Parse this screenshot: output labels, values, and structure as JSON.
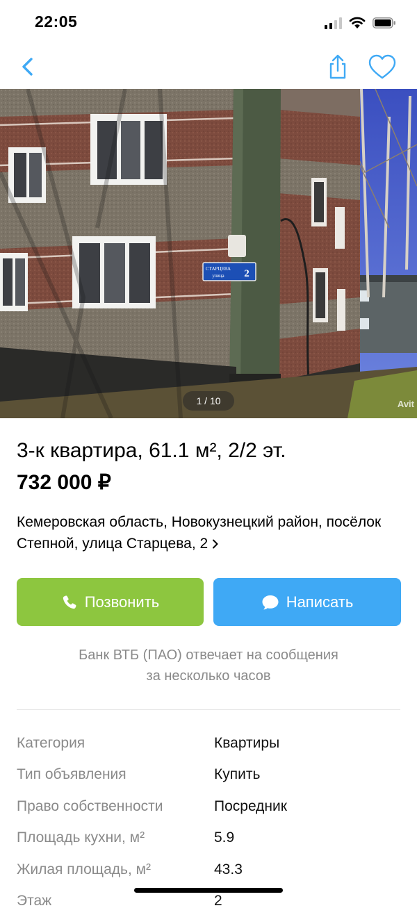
{
  "status_bar": {
    "time": "22:05"
  },
  "nav": {
    "back_icon": "chevron-left-icon",
    "share_icon": "share-icon",
    "favorite_icon": "heart-icon",
    "accent_color": "#3fa9f5"
  },
  "photo": {
    "counter": "1 / 10",
    "watermark": "Avit",
    "street_sign_line1": "СТАРЦЕВА",
    "street_sign_line2": "улица",
    "street_sign_number": "2"
  },
  "listing": {
    "title": "3-к квартира, 61.1 м², 2/2 эт.",
    "price": "732 000 ₽",
    "address": "Кемеровская область, Новокузнецкий район, посёлок Степной, улица Старцева, 2"
  },
  "actions": {
    "call_label": "Позвонить",
    "call_color": "#8dc63f",
    "write_label": "Написать",
    "write_color": "#3fa9f5"
  },
  "reply_note": {
    "line1": "Банк ВТБ (ПАО) отвечает на сообщения",
    "line2": "за несколько часов"
  },
  "params": [
    {
      "label": "Категория",
      "value": "Квартиры"
    },
    {
      "label": "Тип объявления",
      "value": "Купить"
    },
    {
      "label": "Право собственности",
      "value": "Посредник"
    },
    {
      "label": "Площадь кухни, м²",
      "value": "5.9"
    },
    {
      "label": "Жилая площадь, м²",
      "value": "43.3"
    },
    {
      "label": "Этаж",
      "value": "2"
    }
  ]
}
